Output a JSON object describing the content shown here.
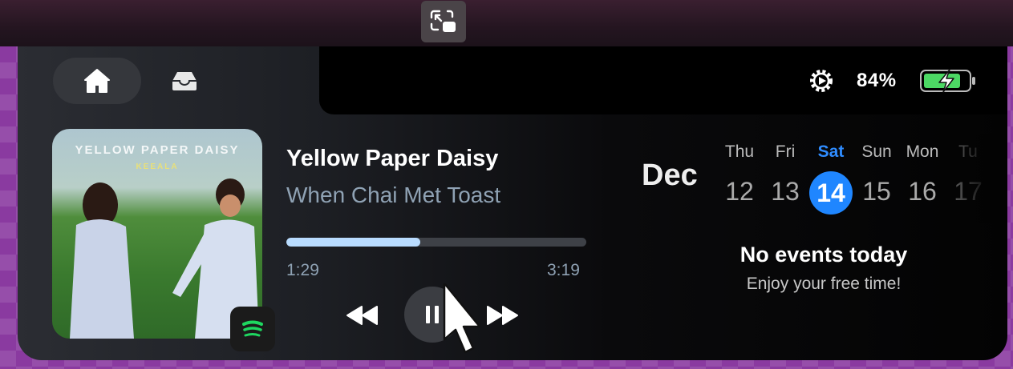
{
  "window": {
    "restore_icon": "restore-window-icon"
  },
  "tabs": [
    {
      "name": "home",
      "icon": "house-icon",
      "active": true
    },
    {
      "name": "shelf",
      "icon": "tray-icon",
      "active": false
    }
  ],
  "status": {
    "settings_icon": "gear-icon",
    "battery_percent": "84%",
    "battery_level": 0.84,
    "charging": true,
    "battery_color": "#4cd964"
  },
  "player": {
    "album_art_title": "YELLOW PAPER DAISY",
    "album_art_subtitle": "KEEALA",
    "title": "Yellow Paper Daisy",
    "artist": "When Chai Met Toast",
    "elapsed": "1:29",
    "duration": "3:19",
    "progress": 0.447,
    "source_icon": "spotify-icon",
    "accent": "#b9dcff",
    "controls": {
      "previous_icon": "rewind-icon",
      "playpause_icon": "pause-icon",
      "next_icon": "fast-forward-icon"
    }
  },
  "calendar": {
    "month": "Dec",
    "days": [
      {
        "day": "Thu",
        "date": "12"
      },
      {
        "day": "Fri",
        "date": "13"
      },
      {
        "day": "Sat",
        "date": "14"
      },
      {
        "day": "Sun",
        "date": "15"
      },
      {
        "day": "Mon",
        "date": "16"
      },
      {
        "day": "Tu",
        "date": "17"
      }
    ],
    "selected_index": 2,
    "selected_color": "#1f86ff",
    "empty_title": "No events today",
    "empty_subtitle": "Enjoy your free time!"
  }
}
